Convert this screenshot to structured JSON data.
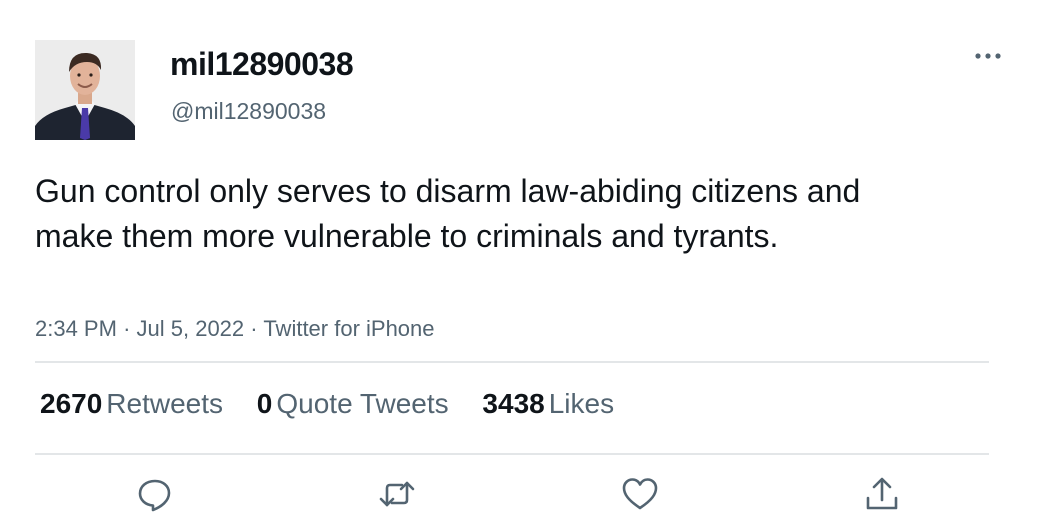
{
  "tweet": {
    "author": {
      "display_name": "mil12890038",
      "handle": "@mil12890038",
      "avatar_icon": "profile-photo"
    },
    "text": "Gun control only serves to disarm law-abiding citizens and make them more vulnerable to criminals and tyrants.",
    "time": "2:34 PM",
    "separator": "·",
    "date": "Jul 5, 2022",
    "source": "Twitter for iPhone",
    "stats": {
      "retweets_count": "2670",
      "retweets_label": "Retweets",
      "quote_tweets_count": "0",
      "quote_tweets_label": "Quote Tweets",
      "likes_count": "3438",
      "likes_label": "Likes"
    },
    "actions": [
      "reply-icon",
      "retweet-icon",
      "like-icon",
      "share-icon"
    ],
    "more_icon": "more-horizontal-icon"
  },
  "colors": {
    "text_primary": "#0f1419",
    "text_secondary": "#536471",
    "divider": "#e3e6e8",
    "icon": "#536471"
  }
}
